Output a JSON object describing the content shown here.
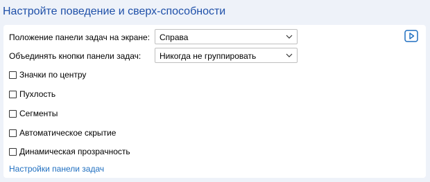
{
  "header": {
    "title": "Настройте поведение и сверх-способности"
  },
  "settings": {
    "position": {
      "label": "Положение панели задач на экране:",
      "value": "Справа"
    },
    "combine": {
      "label": "Объединять кнопки панели задач:",
      "value": "Никогда не группировать"
    }
  },
  "checkboxes": [
    {
      "label": "Значки по центру",
      "checked": false
    },
    {
      "label": "Пухлость",
      "checked": false
    },
    {
      "label": "Сегменты",
      "checked": false
    },
    {
      "label": "Автоматическое скрытие",
      "checked": false
    },
    {
      "label": "Динамическая прозрачность",
      "checked": false
    }
  ],
  "link": {
    "label": "Настройки панели задач"
  },
  "icons": {
    "video": "play-video-icon",
    "dropdown": "chevron-down-icon"
  },
  "colors": {
    "title": "#1e4fa8",
    "link": "#1f6fc0",
    "accent": "#1f6fc0",
    "background": "#eef2f9",
    "panel": "#ffffff"
  }
}
